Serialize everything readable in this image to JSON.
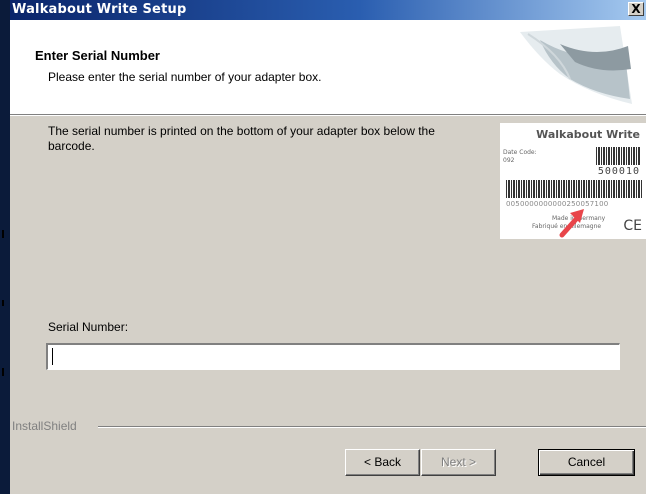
{
  "window": {
    "title": "Walkabout Write Setup",
    "close_glyph": "X"
  },
  "header": {
    "title": "Enter Serial Number",
    "subtitle": "Please enter the serial number of your adapter box."
  },
  "body": {
    "instruction": "The serial number is printed on the bottom of your adapter box below the barcode."
  },
  "label_image": {
    "product": "Walkabout Write",
    "date_code_label": "Date Code:",
    "date_code_value": "092",
    "number": "500010",
    "serial_digits": "0050000000000250057100",
    "made_in": "Made in Germany",
    "fabrique": "Fabriqué en Allemagne",
    "ce_mark": "CE",
    "arrow_color": "#e8454a"
  },
  "serial": {
    "label": "Serial Number:",
    "value": "",
    "placeholder": ""
  },
  "footer": {
    "brand": "InstallShield"
  },
  "buttons": {
    "back": "< Back",
    "next": "Next >",
    "cancel": "Cancel"
  },
  "colors": {
    "titlebar_start": "#0a246a",
    "titlebar_end": "#a6caf0",
    "dialog_bg": "#d4d0c8"
  }
}
